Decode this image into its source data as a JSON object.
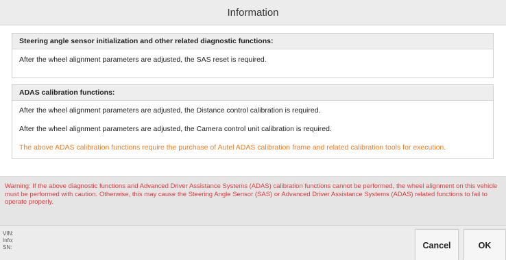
{
  "dialog": {
    "title": "Information"
  },
  "sections": [
    {
      "header": "Steering angle sensor initialization and other related diagnostic functions:",
      "rows": [
        "After the wheel alignment parameters are adjusted, the SAS reset is required."
      ]
    },
    {
      "header": "ADAS calibration functions:",
      "rows": [
        "After the wheel alignment parameters are adjusted, the Distance control calibration is required.",
        "After the wheel alignment parameters are adjusted, the Camera control unit calibration is required."
      ],
      "note": "The above ADAS calibration functions require the purchase of Autel ADAS calibration frame and related calibration tools for execution."
    }
  ],
  "warning": "Warning: If the above diagnostic functions and Advanced Driver Assistance Systems (ADAS) calibration functions cannot be performed, the wheel alignment on this vehicle must be performed with caution. Otherwise, this may cause the Steering Angle Sensor (SAS) or Advanced Driver Assistance Systems (ADAS) related functions to fail to operate properly.",
  "footer": {
    "vin_label": "VIN:",
    "info_label": "Info:",
    "sn_label": "SN:",
    "cancel_label": "Cancel",
    "ok_label": "OK"
  },
  "colors": {
    "note_orange": "#f07d24",
    "warning_red": "#e23b3b",
    "title_bar_bg": "#ececec"
  }
}
